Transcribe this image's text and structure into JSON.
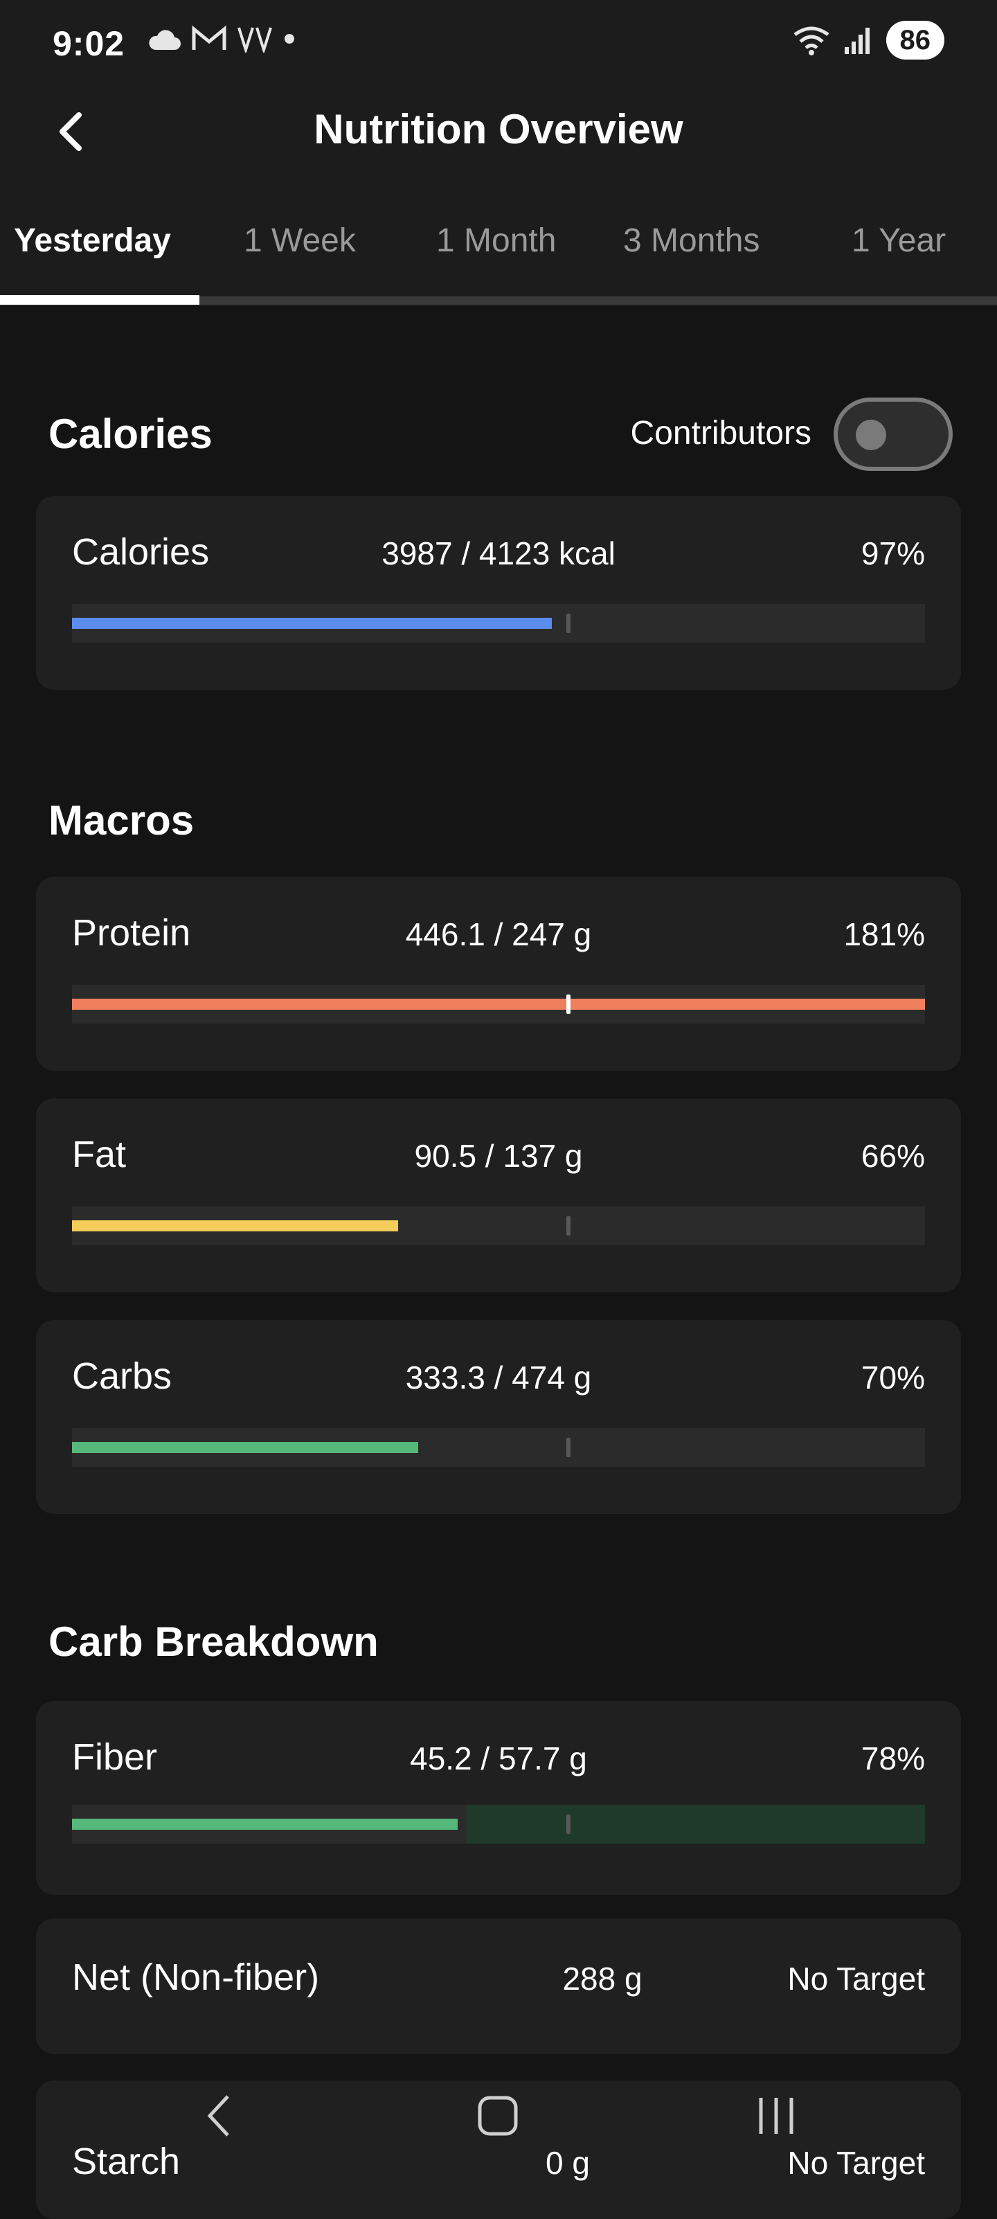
{
  "status": {
    "time": "9:02",
    "battery": "86"
  },
  "header": {
    "title": "Nutrition Overview"
  },
  "tabs": [
    {
      "label": "Yesterday"
    },
    {
      "label": "1 Week"
    },
    {
      "label": "1 Month"
    },
    {
      "label": "3 Months"
    },
    {
      "label": "1 Year"
    }
  ],
  "calories_section": {
    "title": "Calories",
    "contributors_label": "Contributors",
    "contributors_on": false,
    "card": {
      "label": "Calories",
      "value": "3987 / 4123 kcal",
      "pct": "97%",
      "progress": 0.97,
      "color": "#5b8def"
    }
  },
  "macros_section": {
    "title": "Macros",
    "items": [
      {
        "label": "Protein",
        "value": "446.1 / 247 g",
        "pct": "181%",
        "progress": 1.81,
        "color": "#f0805d"
      },
      {
        "label": "Fat",
        "value": "90.5 / 137 g",
        "pct": "66%",
        "progress": 0.66,
        "color": "#f6cd5b"
      },
      {
        "label": "Carbs",
        "value": "333.3 / 474 g",
        "pct": "70%",
        "progress": 0.7,
        "color": "#56b87a"
      }
    ]
  },
  "carb_breakdown": {
    "title": "Carb Breakdown",
    "fiber": {
      "label": "Fiber",
      "value": "45.2 / 57.7 g",
      "pct": "78%",
      "progress": 0.78,
      "color": "#56b87a",
      "target_zone_color": "#1f3a2a"
    },
    "net": {
      "label": "Net (Non-fiber)",
      "value": "288 g",
      "target": "No Target"
    },
    "starch": {
      "label": "Starch",
      "value": "0 g",
      "target": "No Target"
    }
  },
  "colors": {
    "background": "#141414",
    "card": "#202020",
    "track": "#2b2b2b"
  }
}
